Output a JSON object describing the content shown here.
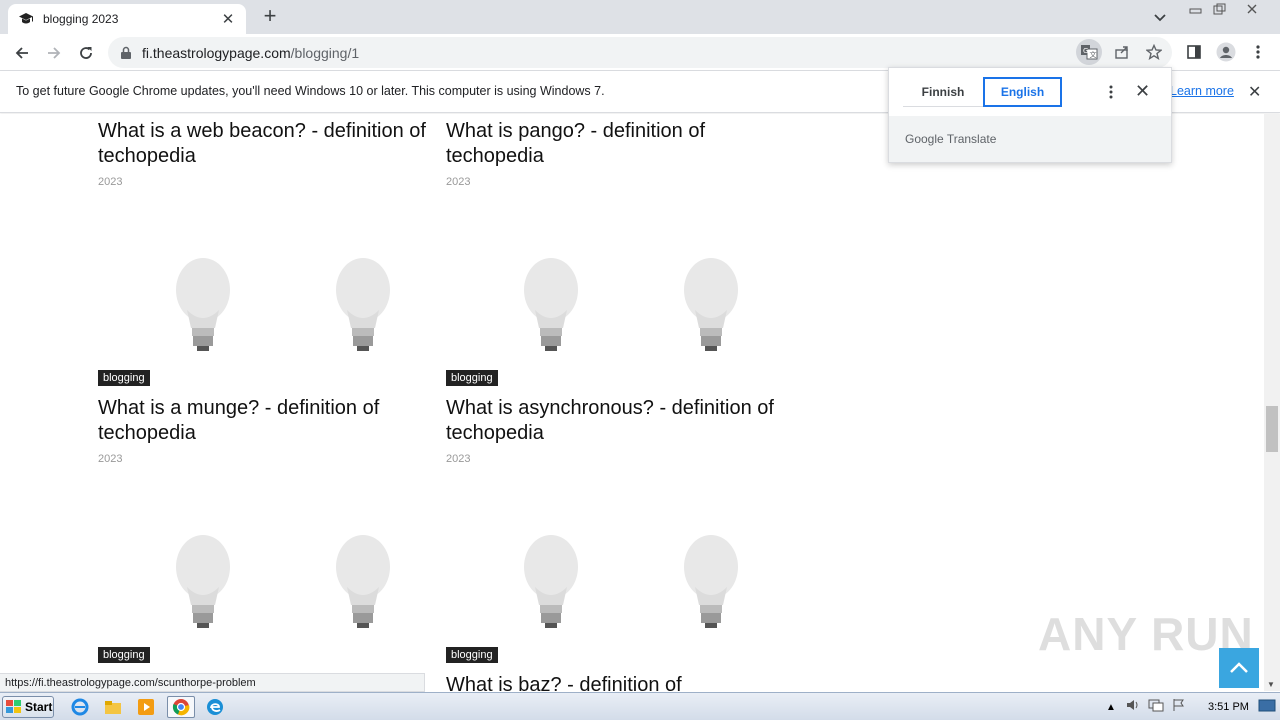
{
  "browser": {
    "tab_title": "blogging 2023",
    "url_domain": "fi.theastrologypage.com",
    "url_path": "/blogging/1"
  },
  "infobar": {
    "message": "To get future Google Chrome updates, you'll need Windows 10 or later. This computer is using Windows 7.",
    "learn_more": "Learn more"
  },
  "translate": {
    "source_lang": "Finnish",
    "target_lang": "English",
    "footer": "Google Translate"
  },
  "cards": [
    {
      "title": "What is a web beacon? - definition of techopedia",
      "year": "2023"
    },
    {
      "title": "What is pango? - definition of techopedia",
      "year": "2023"
    },
    {
      "badge": "blogging",
      "title": "What is a munge? - definition of techopedia",
      "year": "2023"
    },
    {
      "badge": "blogging",
      "title": "What is asynchronous? - definition of techopedia",
      "year": "2023"
    },
    {
      "badge": "blogging"
    },
    {
      "badge": "blogging",
      "title": "What is baz? - definition of"
    }
  ],
  "status_url": "https://fi.theastrologypage.com/scunthorpe-problem",
  "watermark": "ANY RUN",
  "taskbar": {
    "start_label": "Start",
    "clock": "3:51 PM"
  },
  "colors": {
    "accent": "#1a73e8",
    "badge_bg": "#222222",
    "back_to_top": "#3aa6e0"
  }
}
